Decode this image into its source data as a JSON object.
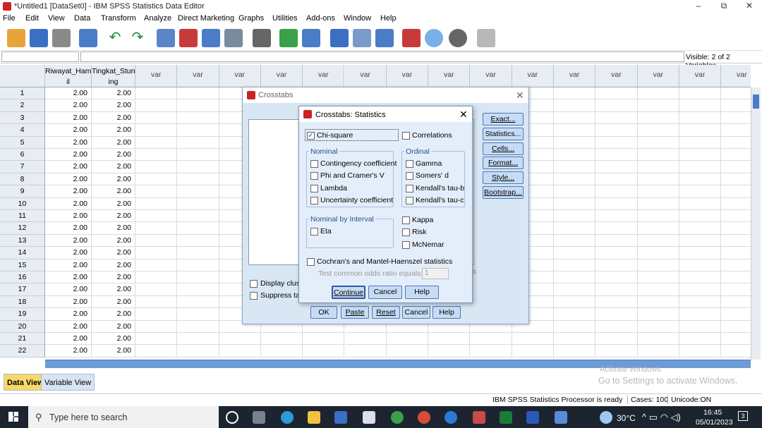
{
  "window": {
    "title": "*Untitled1 [DataSet0] - IBM SPSS Statistics Data Editor",
    "minimize": "–",
    "restore": "⧉",
    "close": "✕"
  },
  "menu": [
    "File",
    "Edit",
    "View",
    "Data",
    "Transform",
    "Analyze",
    "Direct Marketing",
    "Graphs",
    "Utilities",
    "Add-ons",
    "Window",
    "Help"
  ],
  "toolbar_icons": [
    "open-icon",
    "save-icon",
    "print-icon",
    "dialog-recall-icon",
    "undo-icon",
    "redo-icon",
    "goto-case-icon",
    "goto-variable-icon",
    "variables-icon",
    "find-icon",
    "insert-cases-icon",
    "insert-variable-icon",
    "split-file-icon",
    "weight-cases-icon",
    "select-cases-icon",
    "value-labels-icon",
    "use-sets-icon",
    "show-all-icon",
    "spelling-icon"
  ],
  "cellbar": {
    "visible": "Visible: 2 of 2 Variables"
  },
  "grid": {
    "columns": [
      "Riwayat_Ham\nil",
      "Tingkat_Stunt\ning",
      "var",
      "var",
      "var",
      "var",
      "var",
      "var",
      "var",
      "var",
      "var",
      "var",
      "var",
      "var",
      "var",
      "var",
      "var"
    ],
    "rows": [
      [
        "2.00",
        "2.00"
      ],
      [
        "2.00",
        "2.00"
      ],
      [
        "2.00",
        "2.00"
      ],
      [
        "2.00",
        "2.00"
      ],
      [
        "2.00",
        "2.00"
      ],
      [
        "2.00",
        "2.00"
      ],
      [
        "2.00",
        "2.00"
      ],
      [
        "2.00",
        "2.00"
      ],
      [
        "2.00",
        "2.00"
      ],
      [
        "2.00",
        "2.00"
      ],
      [
        "2.00",
        "2.00"
      ],
      [
        "2.00",
        "2.00"
      ],
      [
        "2.00",
        "2.00"
      ],
      [
        "2.00",
        "2.00"
      ],
      [
        "2.00",
        "2.00"
      ],
      [
        "2.00",
        "2.00"
      ],
      [
        "2.00",
        "2.00"
      ],
      [
        "2.00",
        "2.00"
      ],
      [
        "2.00",
        "2.00"
      ],
      [
        "2.00",
        "2.00"
      ],
      [
        "2.00",
        "2.00"
      ],
      [
        "2.00",
        "2.00"
      ]
    ]
  },
  "tabs": {
    "data_view": "Data View",
    "variable_view": "Variable View"
  },
  "status": {
    "processor": "IBM SPSS Statistics Processor is ready",
    "cases": "Cases: 100",
    "unicode": "Unicode:ON",
    "activate_title": "Activate Windows",
    "activate_sub": "Go to Settings to activate Windows."
  },
  "crosstabs": {
    "title": "Crosstabs",
    "close": "✕",
    "side_buttons": [
      "Exact...",
      "Statistics...",
      "Cells...",
      "Format...",
      "Style...",
      "Bootstrap..."
    ],
    "display_clustered": "Display clust",
    "suppress_tables": "Suppress tab",
    "bottom_buttons": [
      "OK",
      "Paste",
      "Reset",
      "Cancel",
      "Help"
    ],
    "hidden_fragment": "s"
  },
  "statistics": {
    "title": "Crosstabs: Statistics",
    "close": "✕",
    "chi_square": "Chi-square",
    "correlations": "Correlations",
    "nominal_label": "Nominal",
    "nominal": [
      "Contingency coefficient",
      "Phi and Cramer's V",
      "Lambda",
      "Uncertainty coefficient"
    ],
    "ordinal_label": "Ordinal",
    "ordinal": [
      "Gamma",
      "Somers' d",
      "Kendall's tau-b",
      "Kendall's tau-c"
    ],
    "nbi_label": "Nominal by Interval",
    "eta": "Eta",
    "kappa": "Kappa",
    "risk": "Risk",
    "mcnemar": "McNemar",
    "cochran": "Cochran's and Mantel-Haenszel statistics",
    "odds_label": "Test common odds ratio equals:",
    "odds_value": "1",
    "buttons": [
      "Continue",
      "Cancel",
      "Help"
    ]
  },
  "taskbar": {
    "search_placeholder": "Type here to search",
    "weather": "30°C",
    "time": "16:45",
    "date": "05/01/2023",
    "notification_count": "3"
  },
  "colors": {
    "accent": "#4a78b8",
    "dialog_bg": "#d9e6f4",
    "taskbar": "#1c2430",
    "scrollbar": "#6d9bd6"
  }
}
